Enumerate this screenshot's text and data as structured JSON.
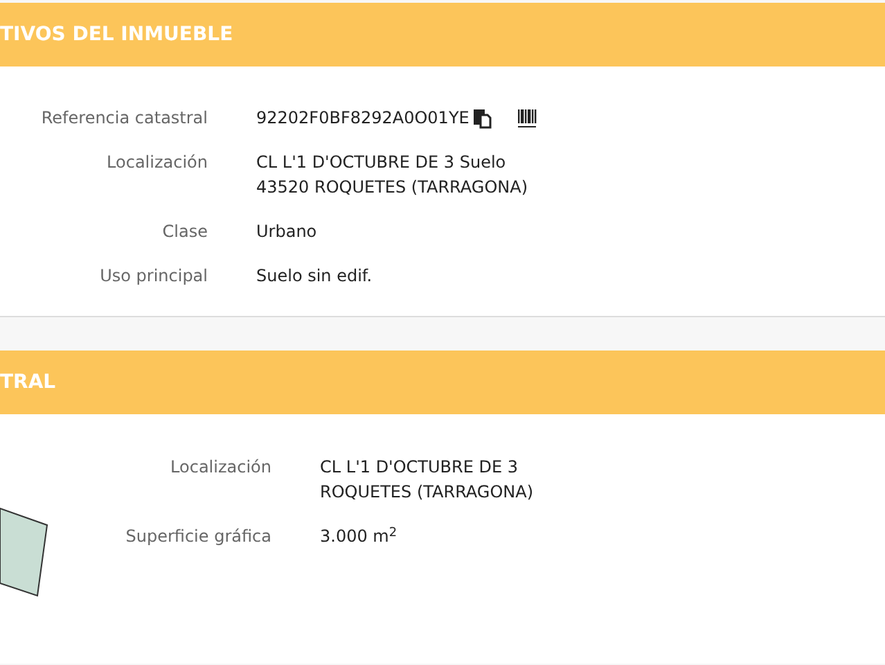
{
  "sections": [
    {
      "title": "TIVOS DEL INMUEBLE",
      "kind": "details",
      "rows": [
        {
          "label": "Referencia catastral",
          "lines": [
            "92202F0BF8292A0O01YE"
          ],
          "actions": [
            {
              "kind": "copy"
            },
            {
              "kind": "barcode"
            }
          ]
        },
        {
          "label": "Localización",
          "lines": [
            "CL L'1 D'OCTUBRE DE 3 Suelo",
            "43520 ROQUETES (TARRAGONA)"
          ]
        },
        {
          "label": "Clase",
          "lines": [
            "Urbano"
          ]
        },
        {
          "label": "Uso principal",
          "lines": [
            "Suelo sin edif."
          ]
        }
      ]
    },
    {
      "title": "TRAL",
      "kind": "parcel",
      "rows": [
        {
          "label": "Localización",
          "lines": [
            "CL L'1 D'OCTUBRE DE 3",
            "ROQUETES (TARRAGONA)"
          ]
        },
        {
          "label": "Superficie gráfica",
          "lines": [
            "3.000 m$^{2}$"
          ]
        }
      ]
    }
  ]
}
